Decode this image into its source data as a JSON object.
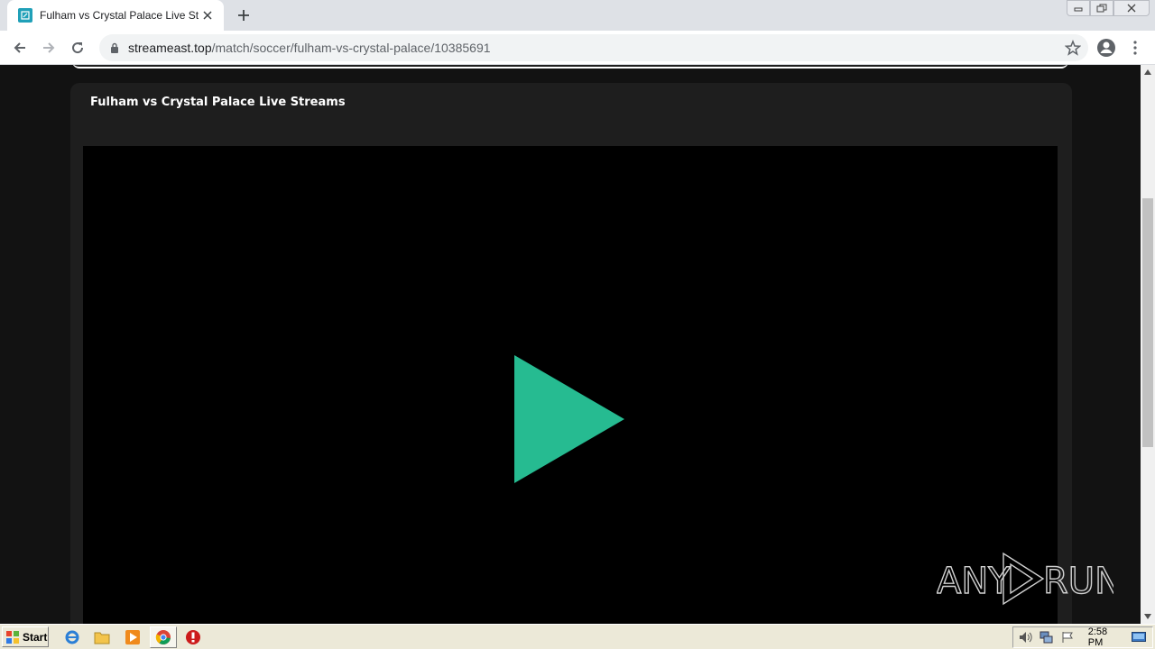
{
  "browser": {
    "tab_title": "Fulham vs Crystal Palace Live Streams",
    "url_host": "streameast.top",
    "url_path": "/match/soccer/fulham-vs-crystal-palace/10385691"
  },
  "page": {
    "stream_title": "Fulham vs Crystal Palace Live Streams",
    "play_button_color": "#26bb91",
    "card_background": "#1e1e1e",
    "player_background": "#000000"
  },
  "watermark": {
    "text_left": "ANY",
    "text_right": "RUN"
  },
  "taskbar": {
    "start_label": "Start",
    "clock": "2:58 PM",
    "icons": [
      "ie-icon",
      "folder-icon",
      "media-player-icon",
      "chrome-icon",
      "opera-icon"
    ]
  }
}
